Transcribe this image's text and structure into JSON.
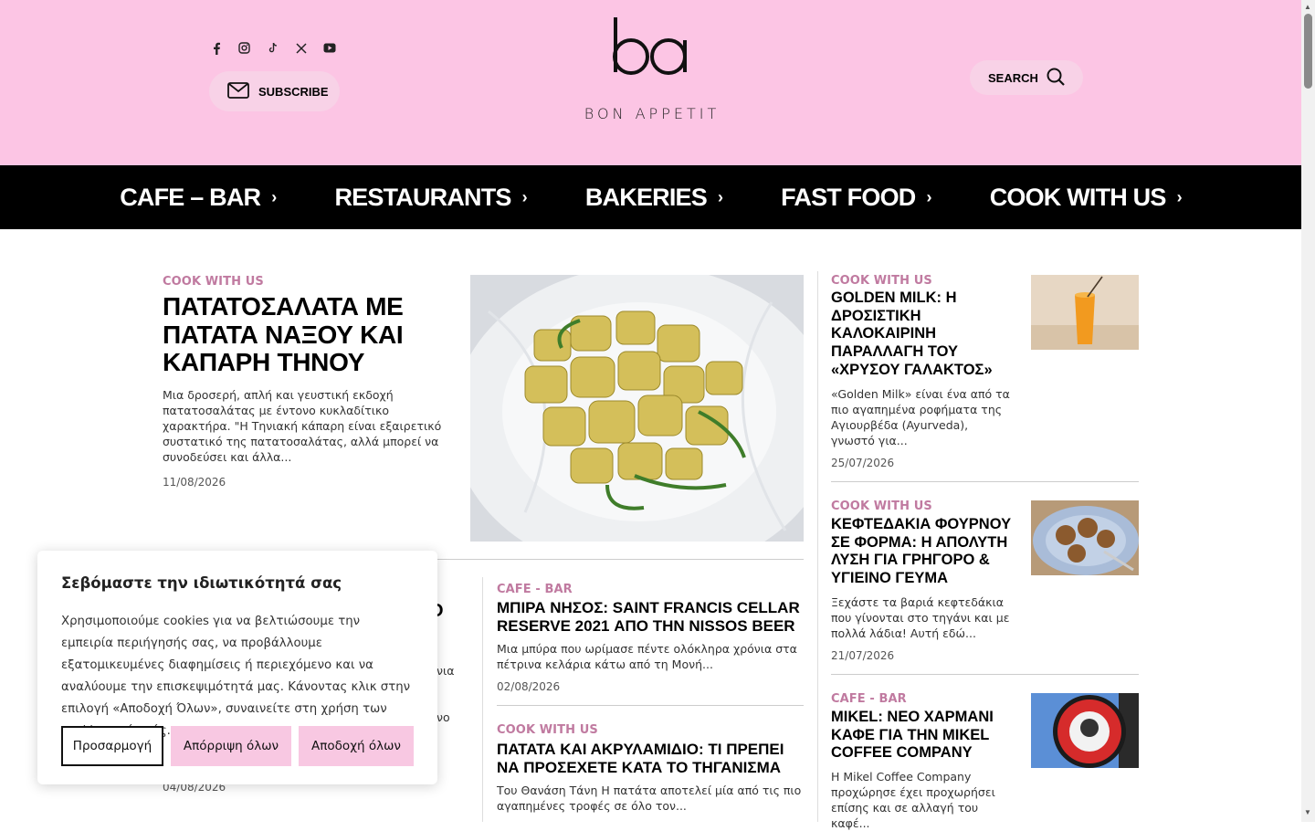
{
  "header": {
    "logo_mark": "ba",
    "logo_tagline": "BON APPETIT",
    "subscribe_label": "SUBSCRIBE",
    "search_label": "SEARCH",
    "socials": [
      "facebook-icon",
      "instagram-icon",
      "tiktok-icon",
      "x-icon",
      "youtube-icon"
    ]
  },
  "nav": {
    "items": [
      {
        "label": "CAFE – BAR",
        "chev": "›"
      },
      {
        "label": "RESTAURANTS",
        "chev": "›"
      },
      {
        "label": "BAKERIES",
        "chev": "›"
      },
      {
        "label": "FAST FOOD",
        "chev": "›"
      },
      {
        "label": "COOK WITH US",
        "chev": "›"
      }
    ]
  },
  "featured": {
    "category": "COOK WITH US",
    "title": "ΠΑΤΑΤΟΣΑΛΑΤΑ ΜΕ ΠΑΤΑΤΑ ΝΑΞΟΥ ΚΑΙ ΚΑΠΑΡΗ ΤΗΝΟΥ",
    "excerpt": "Μια δροσερή, απλή και γευστική εκδοχή πατατοσαλάτας με έντονο κυκλαδίτικο χαρακτήρα. \"Η Τηνιακή κάπαρη είναι εξαιρετικό συστατικό της πατατοσαλάτας, αλλά μπορεί να συνοδεύσει και άλλα...",
    "date": "11/08/2026"
  },
  "middle": [
    {
      "category": "CAFE - BAR",
      "title": "ΜΠΙΡΑ ΝΗΣΟΣ: SAINT FRANCIS CELLAR RESERVE 2021 ΑΠΟ ΤΗΝ NISSOS BEER",
      "excerpt": "Μια μπύρα που ωρίμασε πέντε ολόκληρα χρόνια στα πέτρινα κελάρια κάτω από τη Μονή...",
      "date": "02/08/2026"
    },
    {
      "category": "COOK WITH US",
      "title": "ΠΑΤΑΤΑ ΚΑΙ ΑΚΡΥΛΑΜΙΔΙΟ: ΤΙ ΠΡΕΠΕΙ ΝΑ ΠΡΟΣΕΧΕΤΕ ΚΑΤΑ ΤΟ ΤΗΓΑΝΙΣΜΑ",
      "excerpt": "Του Θανάση Τάνη Η πατάτα αποτελεί μία από τις πιο αγαπημένες τροφές σε όλο τον..."
    }
  ],
  "left_fragments": {
    "title_tail": "Ο",
    "line1_tail": "νια",
    "line2_tail": "νο",
    "date": "04/08/2026"
  },
  "sidebar": [
    {
      "category": "COOK WITH US",
      "title": "GOLDEN MILK: Η ΔΡΟΣΙΣΤΙΚΗ ΚΑΛΟΚΑΙΡΙΝΗ ΠΑΡΑΛΛΑΓΗ ΤΟΥ «ΧΡΥΣΟΥ ΓΑΛΑΚΤΟΣ»",
      "excerpt": "«Golden Milk» είναι ένα από τα πιο αγαπημένα ροφήματα της Αγιουρβέδα (Ayurveda), γνωστό για...",
      "date": "25/07/2026"
    },
    {
      "category": "COOK WITH US",
      "title": "ΚΕΦΤΕΔΑΚΙΑ ΦΟΥΡΝΟΥ ΣΕ ΦΟΡΜΑ: Η ΑΠΟΛΥΤΗ ΛΥΣΗ ΓΙΑ ΓΡΗΓΟΡΟ & ΥΓΙΕΙΝΟ ΓΕΥΜΑ",
      "excerpt": "Ξεχάστε τα βαριά κεφτεδάκια που γίνονται στο τηγάνι και με πολλά λάδια! Αυτή εδώ...",
      "date": "21/07/2026"
    },
    {
      "category": "CAFE - BAR",
      "title": "MIKEL: ΝΕΟ ΧΑΡΜΑΝΙ ΚΑΦΕ ΓΙΑ ΤΗΝ MIKEL COFFEE COMPANY",
      "excerpt": "Η Mikel Coffee Company προχώρησε έχει προχωρήσει επίσης και σε αλλαγή του καφέ..."
    }
  ],
  "cookie": {
    "title": "Σεβόμαστε την ιδιωτικότητά σας",
    "text": "Χρησιμοποιούμε cookies για να βελτιώσουμε την εμπειρία περιήγησής σας, να προβάλλουμε εξατομικευμένες διαφημίσεις ή περιεχόμενο και να αναλύουμε την επισκεψιμότητά μας. Κάνοντας κλικ στην επιλογή «Αποδοχή Όλων», συναινείτε στη χρήση των cookies από εμάς.",
    "customize_label": "Προσαρμογή",
    "reject_label": "Απόρριψη όλων",
    "accept_label": "Αποδοχή όλων"
  },
  "colors": {
    "header_bg": "#fcc5e4",
    "nav_bg": "#000000",
    "category": "#c07aa0",
    "button_pink": "#f8c8e2"
  }
}
